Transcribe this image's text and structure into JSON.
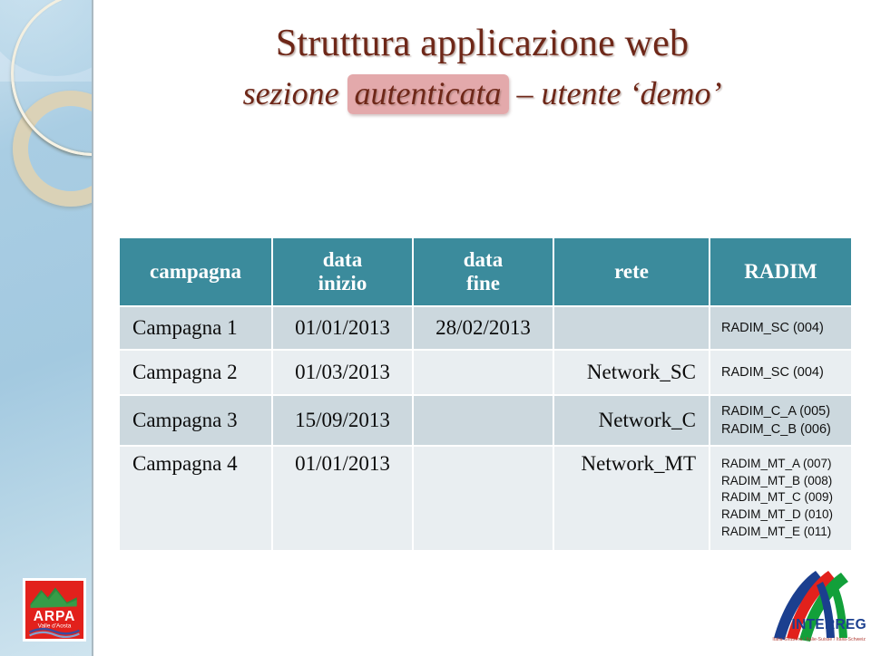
{
  "slide": {
    "title_line1": "Struttura applicazione web",
    "title_line2_before": "sezione ",
    "title_line2_highlight": "autenticata",
    "title_line2_after": " – utente ‘demo’",
    "colors": {
      "title_text": "#6e2718",
      "highlight_bg": "#e3a9ab",
      "table_header_bg": "#3b8b9c",
      "table_header_text": "#ffffff",
      "row_odd_bg": "#ccd8de",
      "row_even_bg": "#e9eef1",
      "sidebar_gradient_start": "#cfe3ef",
      "sidebar_gradient_end": "#a3c9e0",
      "ring_cream": "#f3efe0",
      "ring_tan": "#dfd3b4"
    }
  },
  "table": {
    "headers": {
      "campagna": "campagna",
      "data_inizio_l1": "data",
      "data_inizio_l2": "inizio",
      "data_fine_l1": "data",
      "data_fine_l2": "fine",
      "rete": "rete",
      "radim": "RADIM"
    },
    "rows": [
      {
        "campagna": "Campagna 1",
        "data_inizio": "01/01/2013",
        "data_fine": "28/02/2013",
        "rete": "",
        "radim": [
          "RADIM_SC (004)"
        ]
      },
      {
        "campagna": "Campagna 2",
        "data_inizio": "01/03/2013",
        "data_fine": "",
        "rete": "Network_SC",
        "radim": [
          "RADIM_SC (004)"
        ]
      },
      {
        "campagna": "Campagna 3",
        "data_inizio": "15/09/2013",
        "data_fine": "",
        "rete": "Network_C",
        "radim": [
          "RADIM_C_A (005)",
          "RADIM_C_B (006)"
        ]
      },
      {
        "campagna": "Campagna 4",
        "data_inizio": "01/01/2013",
        "data_fine": "",
        "rete": "Network_MT",
        "radim": [
          "RADIM_MT_A (007)",
          "RADIM_MT_B (008)",
          "RADIM_MT_C (009)",
          "RADIM_MT_D (010)",
          "RADIM_MT_E (011)"
        ]
      }
    ]
  },
  "logos": {
    "arpa": {
      "name": "ARPA",
      "subtitle": "Valle d'Aosta"
    },
    "interreg": {
      "name": "INTERREG",
      "subtitle": "Italia-Svizzera / Italie-Suisse / Italia-Schweiz"
    }
  }
}
